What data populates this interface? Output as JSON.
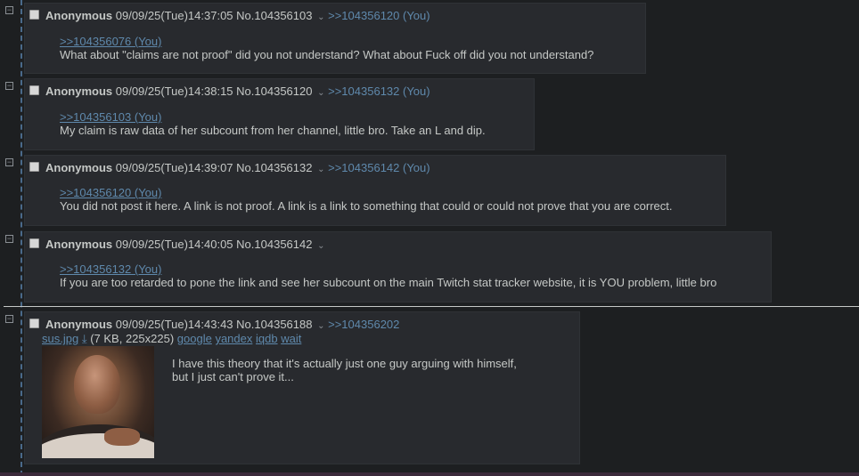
{
  "posts": [
    {
      "name": "Anonymous",
      "datetime": "09/09/25(Tue)14:37:05",
      "no_label": "No.104356103",
      "backlinks": ">>104356120 (You)",
      "quote": ">>104356076 (You)",
      "text": "What about \"claims are not proof\" did you not understand? What about Fuck off did you not understand?"
    },
    {
      "name": "Anonymous",
      "datetime": "09/09/25(Tue)14:38:15",
      "no_label": "No.104356120",
      "backlinks": ">>104356132 (You)",
      "quote": ">>104356103 (You)",
      "text": "My claim is raw data of her subcount from her channel, little bro. Take an L and dip."
    },
    {
      "name": "Anonymous",
      "datetime": "09/09/25(Tue)14:39:07",
      "no_label": "No.104356132",
      "backlinks": ">>104356142 (You)",
      "quote": ">>104356120 (You)",
      "text": "You did not post it here. A link is not proof. A link is a link to something that could or could not prove that you are correct."
    },
    {
      "name": "Anonymous",
      "datetime": "09/09/25(Tue)14:40:05",
      "no_label": "No.104356142",
      "backlinks": "",
      "quote": ">>104356132 (You)",
      "text": "If you are too retarded to pone the link and see her subcount on the main Twitch stat tracker website, it is YOU problem, little bro"
    },
    {
      "name": "Anonymous",
      "datetime": "09/09/25(Tue)14:43:43",
      "no_label": "No.104356188",
      "backlinks": ">>104356202",
      "file_name": "sus.jpg",
      "file_meta": "(7 KB, 225x225)",
      "search_links": [
        "google",
        "yandex",
        "iqdb",
        "wait"
      ],
      "text_lines": [
        "I have this theory that it's actually just one guy arguing with himself,",
        "but I just can't prove it..."
      ]
    }
  ],
  "icons": {
    "collapse": "minus-box-icon",
    "menu": "chevron-down-icon",
    "download": "download-icon"
  }
}
